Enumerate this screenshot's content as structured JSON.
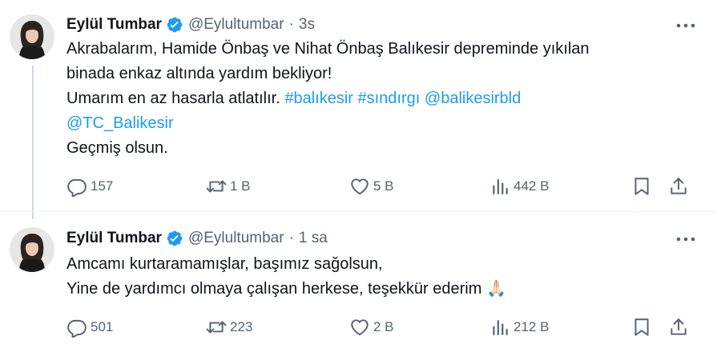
{
  "tweets": [
    {
      "author": {
        "name": "Eylül Tumbar",
        "handle": "@Eylultumbar",
        "avatar": "avatar-photo"
      },
      "separator": "·",
      "time": "3s",
      "text": {
        "line1": "Akrabalarım, Hamide Önbaş ve Nihat Önbaş Balıkesir depreminde yıkılan",
        "line2": "binada enkaz altında yardım bekliyor!",
        "line3_prefix": "Umarım en az hasarla atlatılır. ",
        "hashtag1": "#balıkesir",
        "hashtag2": "#sındırgı",
        "mention1": "@balikesirbld",
        "mention2": "@TC_Balikesir",
        "line5": "Geçmiş olsun."
      },
      "stats": {
        "replies": "157",
        "reposts": "1 B",
        "likes": "5 B",
        "views": "442 B"
      }
    },
    {
      "author": {
        "name": "Eylül Tumbar",
        "handle": "@Eylultumbar",
        "avatar": "avatar-photo"
      },
      "separator": "·",
      "time": "1 sa",
      "text": {
        "line1": "Amcamı kurtaramamışlar, başımız sağolsun,",
        "line2": "Yine de yardımcı olmaya çalışan herkese, teşekkür ederim",
        "emoji": "🙏🏻"
      },
      "stats": {
        "replies": "501",
        "reposts": "223",
        "likes": "2 B",
        "views": "212 B"
      }
    }
  ],
  "icons": {
    "verified": "verified-badge-icon",
    "more": "more-icon",
    "reply": "reply-icon",
    "repost": "repost-icon",
    "like": "heart-icon",
    "views": "views-icon",
    "bookmark": "bookmark-icon",
    "share": "share-icon"
  },
  "colors": {
    "link": "#1d9bf0",
    "verified": "#1d9bf0",
    "muted": "#536471",
    "text": "#0f1419"
  }
}
